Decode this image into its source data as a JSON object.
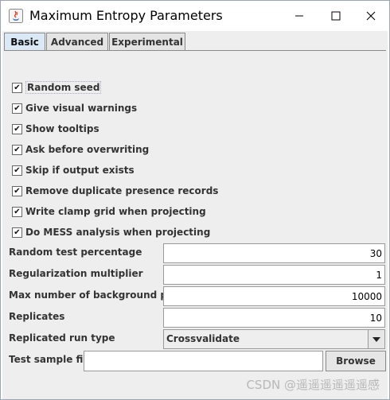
{
  "window": {
    "title": "Maximum Entropy Parameters",
    "controls": {
      "minimize": "minimize-icon",
      "maximize": "maximize-icon",
      "close": "close-icon"
    }
  },
  "tabs": [
    {
      "label": "Basic",
      "active": true
    },
    {
      "label": "Advanced",
      "active": false
    },
    {
      "label": "Experimental",
      "active": false
    }
  ],
  "checkboxes": [
    {
      "label": "Random seed",
      "checked": true
    },
    {
      "label": "Give visual warnings",
      "checked": true
    },
    {
      "label": "Show tooltips",
      "checked": true
    },
    {
      "label": "Ask before overwriting",
      "checked": true
    },
    {
      "label": "Skip if output exists",
      "checked": true
    },
    {
      "label": "Remove duplicate presence records",
      "checked": true
    },
    {
      "label": "Write clamp grid when projecting",
      "checked": true
    },
    {
      "label": "Do MESS analysis when projecting",
      "checked": true
    }
  ],
  "fields": [
    {
      "label": "Random test percentage",
      "value": "30"
    },
    {
      "label": "Regularization multiplier",
      "value": "1"
    },
    {
      "label": "Max number of background points",
      "value": "10000"
    },
    {
      "label": "Replicates",
      "value": "10"
    }
  ],
  "replicated_run_type": {
    "label": "Replicated run type",
    "value": "Crossvalidate"
  },
  "test_sample_file": {
    "label": "Test sample file",
    "value": "",
    "browse_label": "Browse"
  },
  "watermark": "CSDN @遥遥遥遥遥遥感",
  "colors": {
    "active_tab": "#dbe8f6",
    "panel_bg": "#eeeeee"
  }
}
